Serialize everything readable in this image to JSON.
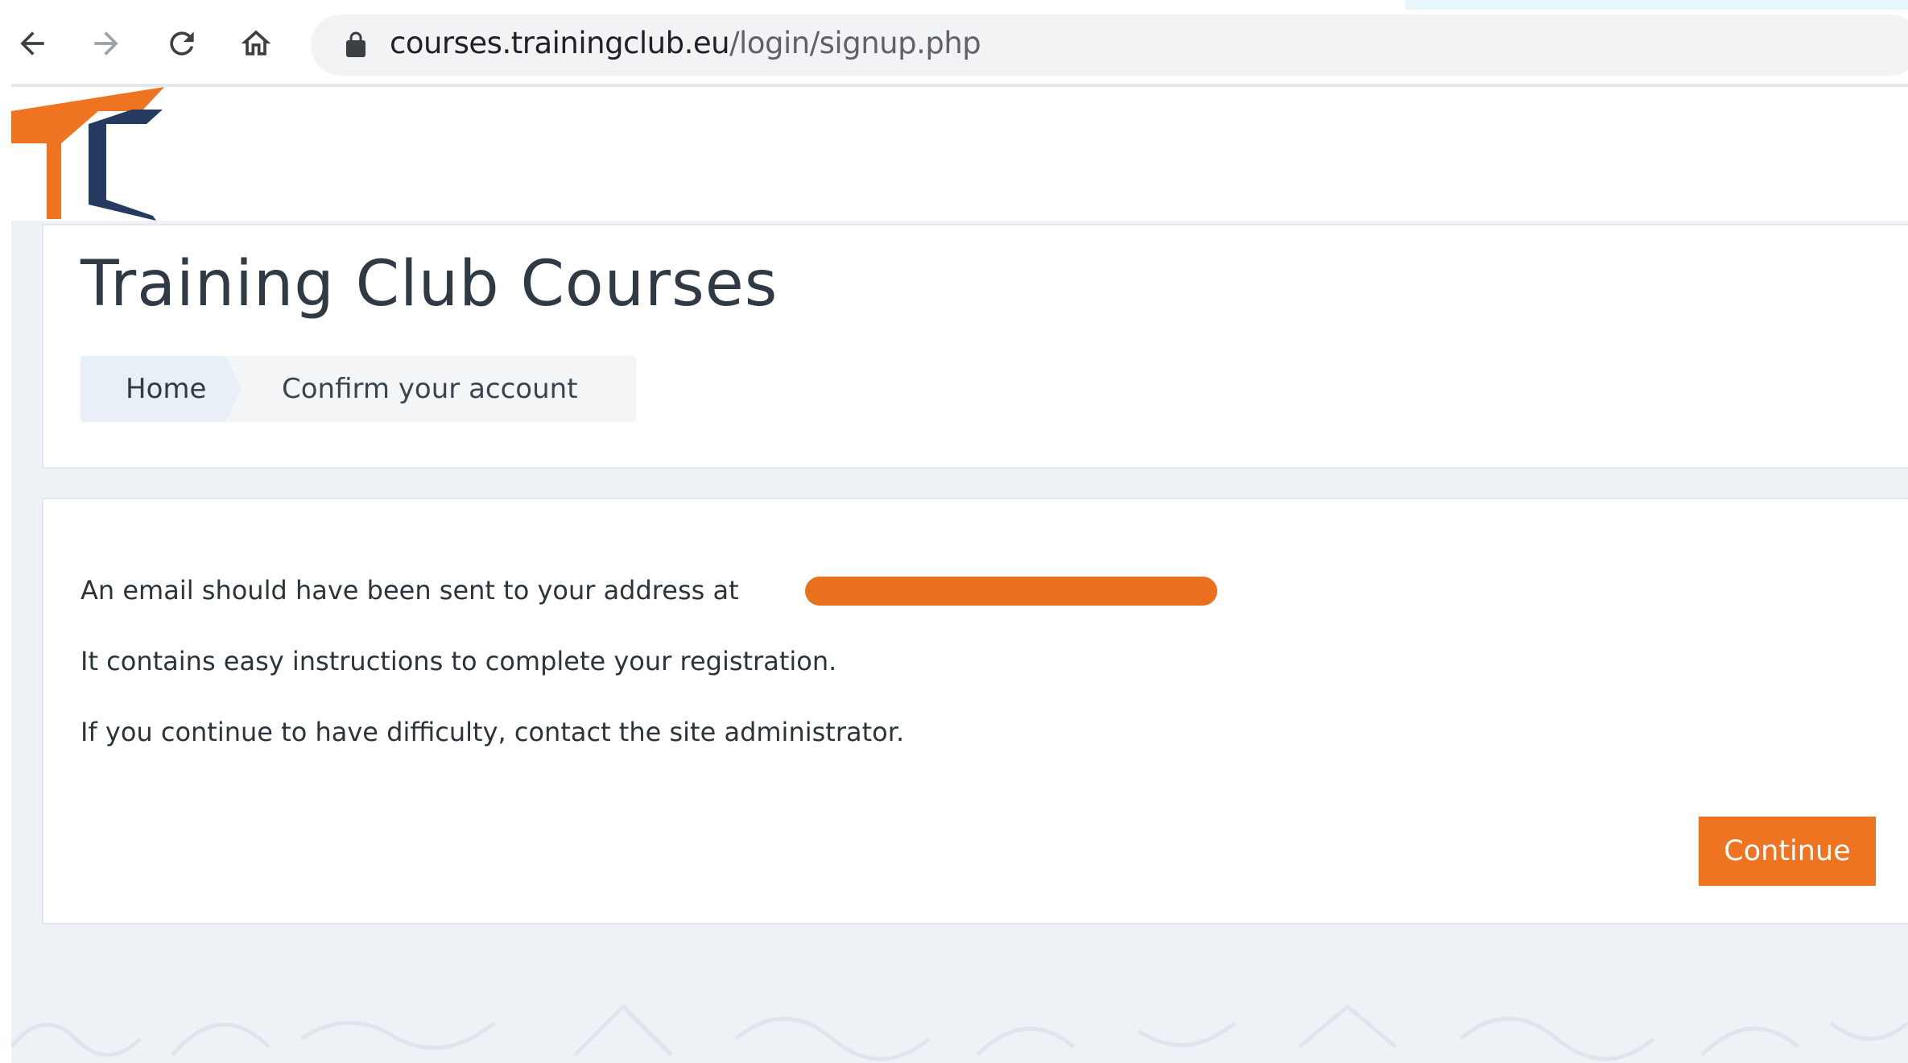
{
  "browser": {
    "url_domain": "courses.trainingclub.eu",
    "url_path": "/login/signup.php",
    "back_icon": "back-arrow-icon",
    "forward_icon": "forward-arrow-icon",
    "reload_icon": "reload-icon",
    "home_icon": "home-icon",
    "lock_icon": "lock-icon"
  },
  "site": {
    "logo_icon": "training-club-logo",
    "title": "Training Club Courses"
  },
  "breadcrumb": {
    "home": "Home",
    "current": "Confirm your account"
  },
  "message": {
    "line1": "An email should have been sent to your address at",
    "line2": "It contains easy instructions to complete your registration.",
    "line3": "If you continue to have difficulty, contact the site administrator."
  },
  "actions": {
    "continue_label": "Continue"
  },
  "colors": {
    "accent": "#ee7421",
    "logo_blue": "#243a5e",
    "title_text": "#2f3a44",
    "page_background": "#eef2f6"
  }
}
